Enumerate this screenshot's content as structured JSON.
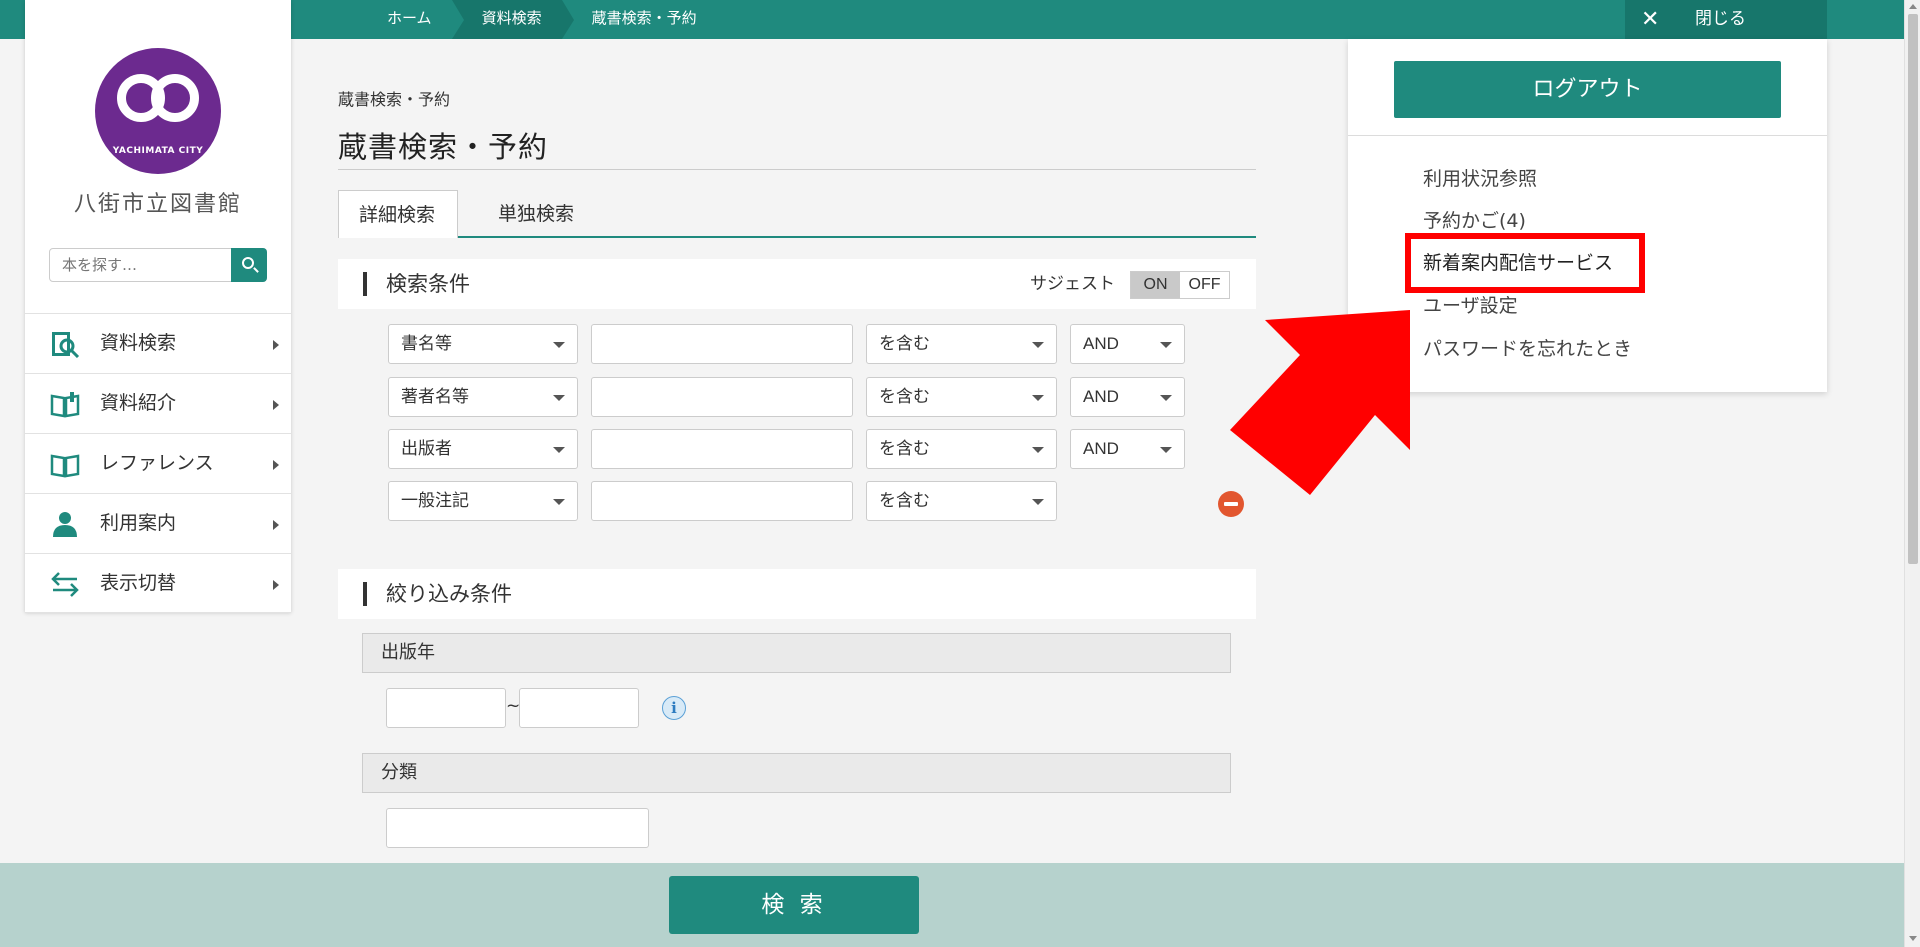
{
  "topbar": {
    "crumbs": [
      "ホーム",
      "資料検索",
      "蔵書検索・予約"
    ],
    "close_label": "閉じる",
    "close_icon": "close-icon"
  },
  "sidebar": {
    "logo_text": "YACHIMATA CITY",
    "library_name": "八街市立図書館",
    "search_placeholder": "本を探す…",
    "items": [
      {
        "label": "資料検索",
        "icon": "book-search-icon"
      },
      {
        "label": "資料紹介",
        "icon": "open-book-icon"
      },
      {
        "label": "レファレンス",
        "icon": "open-book-icon"
      },
      {
        "label": "利用案内",
        "icon": "person-icon"
      },
      {
        "label": "表示切替",
        "icon": "swap-arrows-icon"
      }
    ]
  },
  "main": {
    "breadcrumb": "蔵書検索・予約",
    "title": "蔵書検索・予約",
    "tabs": [
      {
        "label": "詳細検索",
        "active": true
      },
      {
        "label": "単独検索",
        "active": false
      }
    ],
    "conditions_title": "検索条件",
    "suggest_label": "サジェスト",
    "suggest_on": "ON",
    "suggest_off": "OFF",
    "rows": [
      {
        "field": "書名等",
        "match": "を含む",
        "op": "AND"
      },
      {
        "field": "著者名等",
        "match": "を含む",
        "op": "AND"
      },
      {
        "field": "出版者",
        "match": "を含む",
        "op": "AND"
      },
      {
        "field": "一般注記",
        "match": "を含む",
        "op": ""
      }
    ],
    "filter_title": "絞り込み条件",
    "pubyear_label": "出版年",
    "tilde": "~",
    "info_glyph": "i",
    "classification_label": "分類"
  },
  "bottom": {
    "search_label": "検 索"
  },
  "account_menu": {
    "logout_label": "ログアウト",
    "items": [
      "利用状況参照",
      "予約かご(4)",
      "新着案内配信サービス",
      "ユーザ設定",
      "パスワードを忘れたとき"
    ]
  },
  "colors": {
    "brand_teal": "#1f8a7e",
    "highlight_red": "#ff0000",
    "logo_purple": "#6c2a8f"
  }
}
